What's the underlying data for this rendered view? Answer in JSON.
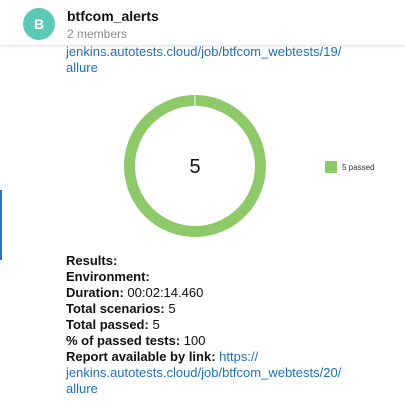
{
  "header": {
    "avatar_letter": "B",
    "title": "btfcom_alerts",
    "subtitle": "2 members"
  },
  "previous_message": {
    "link_line1": "jenkins.autotests.cloud/job/btfcom_webtests/19/",
    "link_line2": "allure"
  },
  "chart_data": {
    "type": "pie",
    "style": "donut",
    "center_label": "5",
    "categories": [
      "5 passed"
    ],
    "values": [
      5
    ],
    "colors": [
      "#8dc968"
    ],
    "legend": "right"
  },
  "results": {
    "results_label": "Results:",
    "environment_label": "Environment:",
    "duration_label": "Duration:",
    "duration_value": "00:02:14.460",
    "scenarios_label": "Total scenarios:",
    "scenarios_value": "5",
    "passed_label": "Total passed:",
    "passed_value": "5",
    "percent_label": "% of passed tests:",
    "percent_value": "100",
    "report_label": "Report available by link:",
    "report_link_part1": "https://",
    "report_link_part2": "jenkins.autotests.cloud/job/btfcom_webtests/20/",
    "report_link_part3": "allure"
  }
}
